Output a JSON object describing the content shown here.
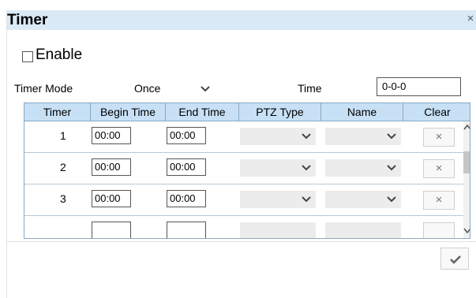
{
  "dialog": {
    "title": "Timer",
    "close_glyph": "×"
  },
  "enable": {
    "label": "Enable",
    "checked": false
  },
  "timer_mode": {
    "label": "Timer Mode",
    "value": "Once"
  },
  "time": {
    "label": "Time",
    "value": "0-0-0"
  },
  "table": {
    "headers": [
      "Timer",
      "Begin Time",
      "End Time",
      "PTZ Type",
      "Name",
      "Clear"
    ],
    "rows": [
      {
        "timer": "1",
        "begin": "00:00",
        "end": "00:00",
        "ptz_type": "",
        "name": "",
        "clear_glyph": "×"
      },
      {
        "timer": "2",
        "begin": "00:00",
        "end": "00:00",
        "ptz_type": "",
        "name": "",
        "clear_glyph": "×"
      },
      {
        "timer": "3",
        "begin": "00:00",
        "end": "00:00",
        "ptz_type": "",
        "name": "",
        "clear_glyph": "×"
      }
    ]
  },
  "icons": {
    "close": "close-icon",
    "dropdown": "chevron-down-icon",
    "clear": "x-icon",
    "confirm": "checkmark-icon",
    "scroll_up": "arrow-up-icon",
    "scroll_down": "arrow-down-icon"
  },
  "colors": {
    "title_bar": "#d9e9f6",
    "grid_header": "#c7e0f5",
    "grid_border": "#8aa8c4",
    "select_bg": "#ececec"
  }
}
